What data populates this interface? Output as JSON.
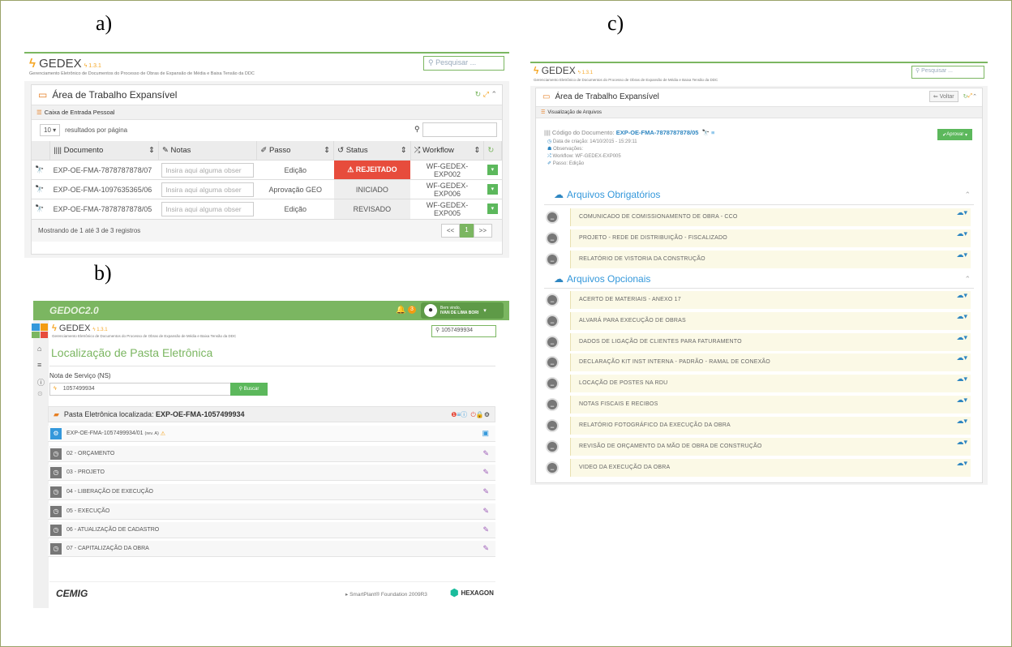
{
  "labels": {
    "a": "a)",
    "b": "b)",
    "c": "c)"
  },
  "gedex": {
    "name": "GEDEX",
    "version": "1.3.1",
    "subtitle": "Gerenciamento Eletrônico de Documentos do Processo de Obras de Expansão de Média e Baixa Tensão da DDC"
  },
  "panel_a": {
    "search_placeholder": "Pesquisar ...",
    "title": "Área de Trabalho Expansível",
    "subtab": "Caixa de Entrada Pessoal",
    "per_page_value": "10",
    "per_page_label": "resultados por página",
    "columns": [
      "Documento",
      "Notas",
      "Passo",
      "Status",
      "Workflow"
    ],
    "note_placeholder": "Insira aqui alguma obser",
    "rows": [
      {
        "doc": "EXP-OE-FMA-7878787878/07",
        "passo": "Edição",
        "status": "REJEITADO",
        "workflow": "WF-GEDEX-EXP002"
      },
      {
        "doc": "EXP-OE-FMA-1097635365/06",
        "passo": "Aprovação GEO",
        "status": "INICIADO",
        "workflow": "WF-GEDEX-EXP006"
      },
      {
        "doc": "EXP-OE-FMA-7878787878/05",
        "passo": "Edição",
        "status": "REVISADO",
        "workflow": "WF-GEDEX-EXP005"
      }
    ],
    "footer": "Mostrando de 1 até 3 de 3 registros",
    "pager": [
      "<<",
      "1",
      ">>"
    ]
  },
  "panel_b": {
    "brand": "GEDOC2.0",
    "notif_count": "3",
    "welcome": "Bem vindo,",
    "user": "IVAN DE LIMA BORI",
    "search_value": "1057499934",
    "page_title": "Localização de Pasta Eletrônica",
    "field_label": "Nota de Serviço (NS)",
    "field_value": "1057499934",
    "search_button": "Buscar",
    "folder_label": "Pasta Eletrônica localizada:",
    "folder_code": "EXP-OE-FMA-1057499934",
    "doc_row": "EXP-OE-FMA-1057499934/01",
    "doc_rev": "(rev. A)",
    "steps": [
      "02 - ORÇAMENTO",
      "03 - PROJETO",
      "04 - LIBERAÇÃO DE EXECUÇÃO",
      "05 - EXECUÇÃO",
      "06 - ATUALIZAÇÃO DE CADASTRO",
      "07 - CAPITALIZAÇÃO DA OBRA"
    ],
    "footer_logo": "CEMIG",
    "footer_text": "SmartPlant® Foundation 2009R3",
    "footer_brand": "HEXAGON"
  },
  "panel_c": {
    "search_placeholder": "Pesquisar ...",
    "title": "Área de Trabalho Expansível",
    "back_button": "Voltar",
    "subtab": "Visualização de Arquivos",
    "code_label": "Código do Documento:",
    "code_value": "EXP-OE-FMA-7878787878/05",
    "approve_button": "Aprovar",
    "meta": [
      "Data de criação: 14/10/2015 - 15:29:11",
      "Observações:",
      "Workflow: WF-GEDEX-EXP005",
      "Passo: Edição"
    ],
    "required_title": "Arquivos Obrigatórios",
    "required": [
      "COMUNICADO DE COMISSIONAMENTO DE OBRA - CCO",
      "PROJETO - REDE DE DISTRIBUIÇÃO - FISCALIZADO",
      "RELATÓRIO DE VISTORIA DA CONSTRUÇÃO"
    ],
    "optional_title": "Arquivos Opcionais",
    "optional": [
      "ACERTO DE MATERIAIS - ANEXO 17",
      "ALVARÁ PARA EXECUÇÃO DE OBRAS",
      "DADOS DE LIGAÇÃO DE CLIENTES PARA FATURAMENTO",
      "DECLARAÇÃO KIT INST INTERNA - PADRÃO - RAMAL DE CONEXÃO",
      "LOCAÇÃO DE POSTES NA RDU",
      "NOTAS FISCAIS E RECIBOS",
      "RELATÓRIO FOTOGRÁFICO DA EXECUÇÃO DA OBRA",
      "REVISÃO DE ORÇAMENTO DA MÃO DE OBRA DE CONSTRUÇÃO",
      "VIDEO DA EXECUÇÃO DA OBRA"
    ]
  }
}
